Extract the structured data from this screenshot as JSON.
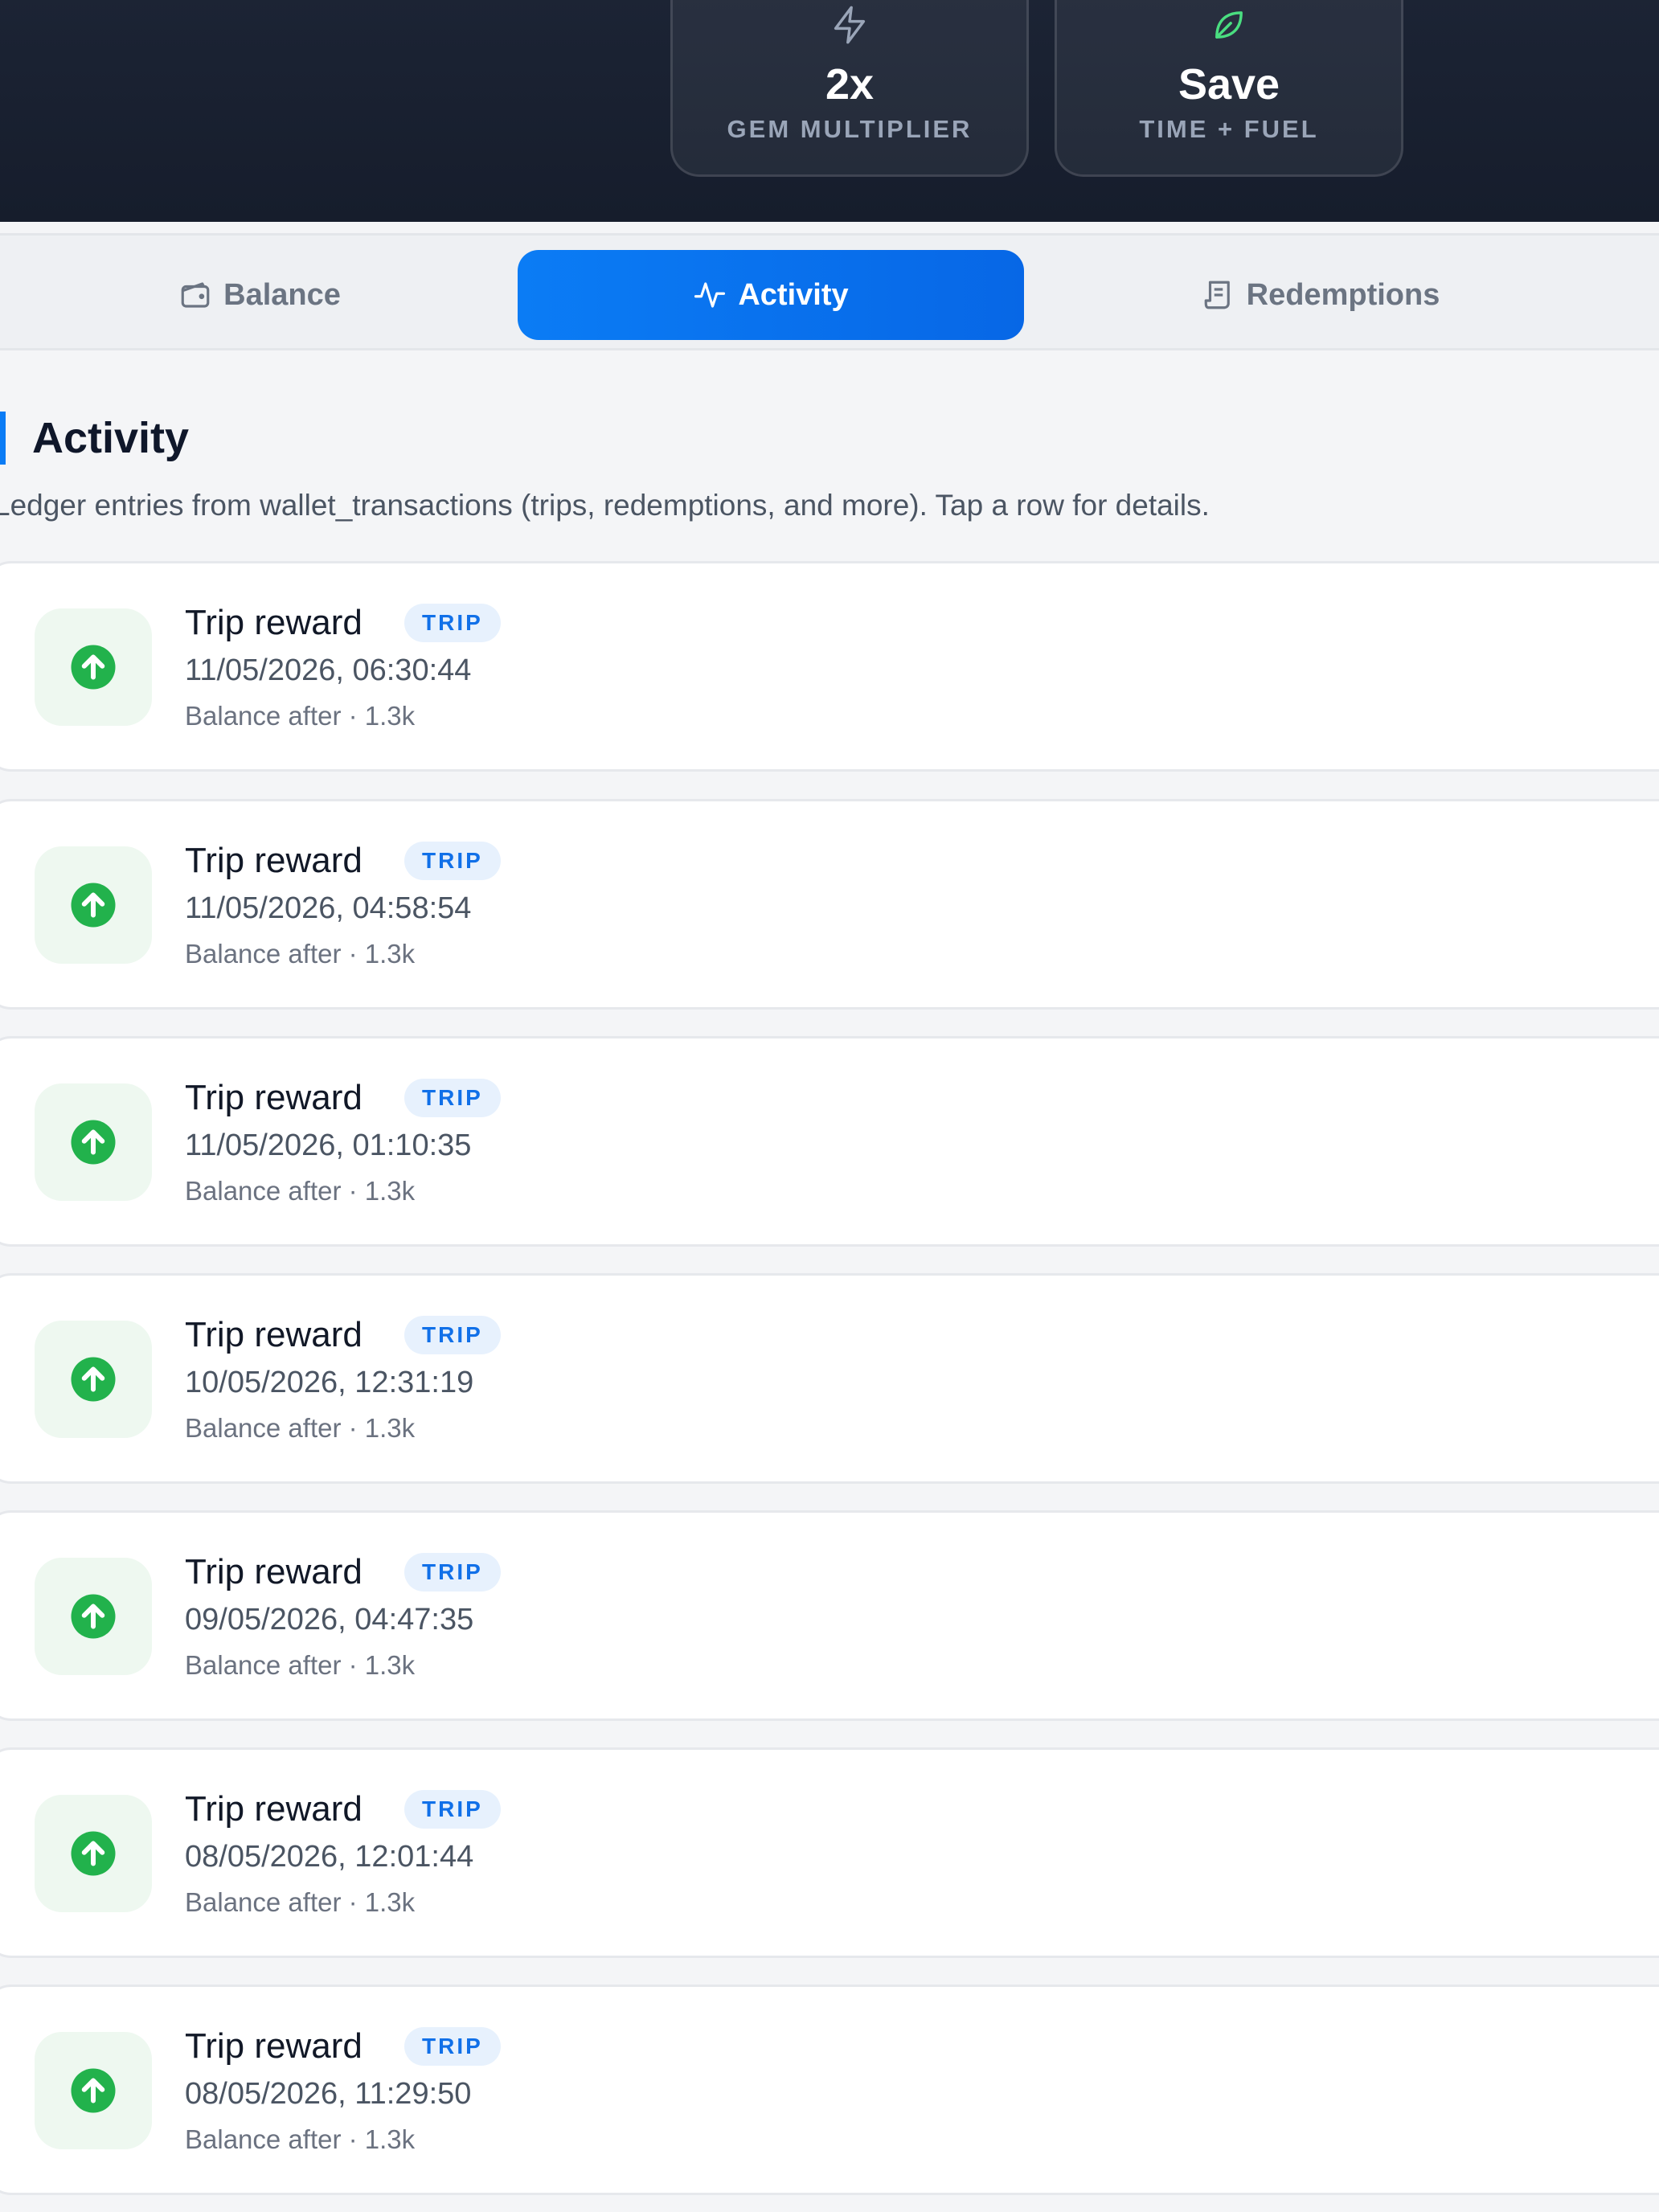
{
  "stats": [
    {
      "value": "2x",
      "label": "GEM MULTIPLIER",
      "icon": "lightning-icon"
    },
    {
      "value": "Save",
      "label": "TIME + FUEL",
      "icon": "leaf-icon"
    }
  ],
  "tabs": [
    {
      "label": "Balance",
      "icon": "wallet-icon",
      "active": false
    },
    {
      "label": "Activity",
      "icon": "activity-icon",
      "active": true
    },
    {
      "label": "Redemptions",
      "icon": "receipt-icon",
      "active": false
    }
  ],
  "section": {
    "title": "Activity",
    "description": "Ledger entries from wallet_transactions (trips, redemptions, and more). Tap a row for details."
  },
  "colors": {
    "accent": "#0b7cf5",
    "positive": "#22b24c",
    "header_bg": "#1a2232"
  },
  "rows": [
    {
      "title": "Trip reward",
      "badge": "TRIP",
      "date": "11/05/2026, 06:30:44",
      "balance": "Balance after · 1.3k",
      "icon": "arrow-up-circle-icon"
    },
    {
      "title": "Trip reward",
      "badge": "TRIP",
      "date": "11/05/2026, 04:58:54",
      "balance": "Balance after · 1.3k",
      "icon": "arrow-up-circle-icon"
    },
    {
      "title": "Trip reward",
      "badge": "TRIP",
      "date": "11/05/2026, 01:10:35",
      "balance": "Balance after · 1.3k",
      "icon": "arrow-up-circle-icon"
    },
    {
      "title": "Trip reward",
      "badge": "TRIP",
      "date": "10/05/2026, 12:31:19",
      "balance": "Balance after · 1.3k",
      "icon": "arrow-up-circle-icon"
    },
    {
      "title": "Trip reward",
      "badge": "TRIP",
      "date": "09/05/2026, 04:47:35",
      "balance": "Balance after · 1.3k",
      "icon": "arrow-up-circle-icon"
    },
    {
      "title": "Trip reward",
      "badge": "TRIP",
      "date": "08/05/2026, 12:01:44",
      "balance": "Balance after · 1.3k",
      "icon": "arrow-up-circle-icon"
    },
    {
      "title": "Trip reward",
      "badge": "TRIP",
      "date": "08/05/2026, 11:29:50",
      "balance": "Balance after · 1.3k",
      "icon": "arrow-up-circle-icon"
    }
  ]
}
